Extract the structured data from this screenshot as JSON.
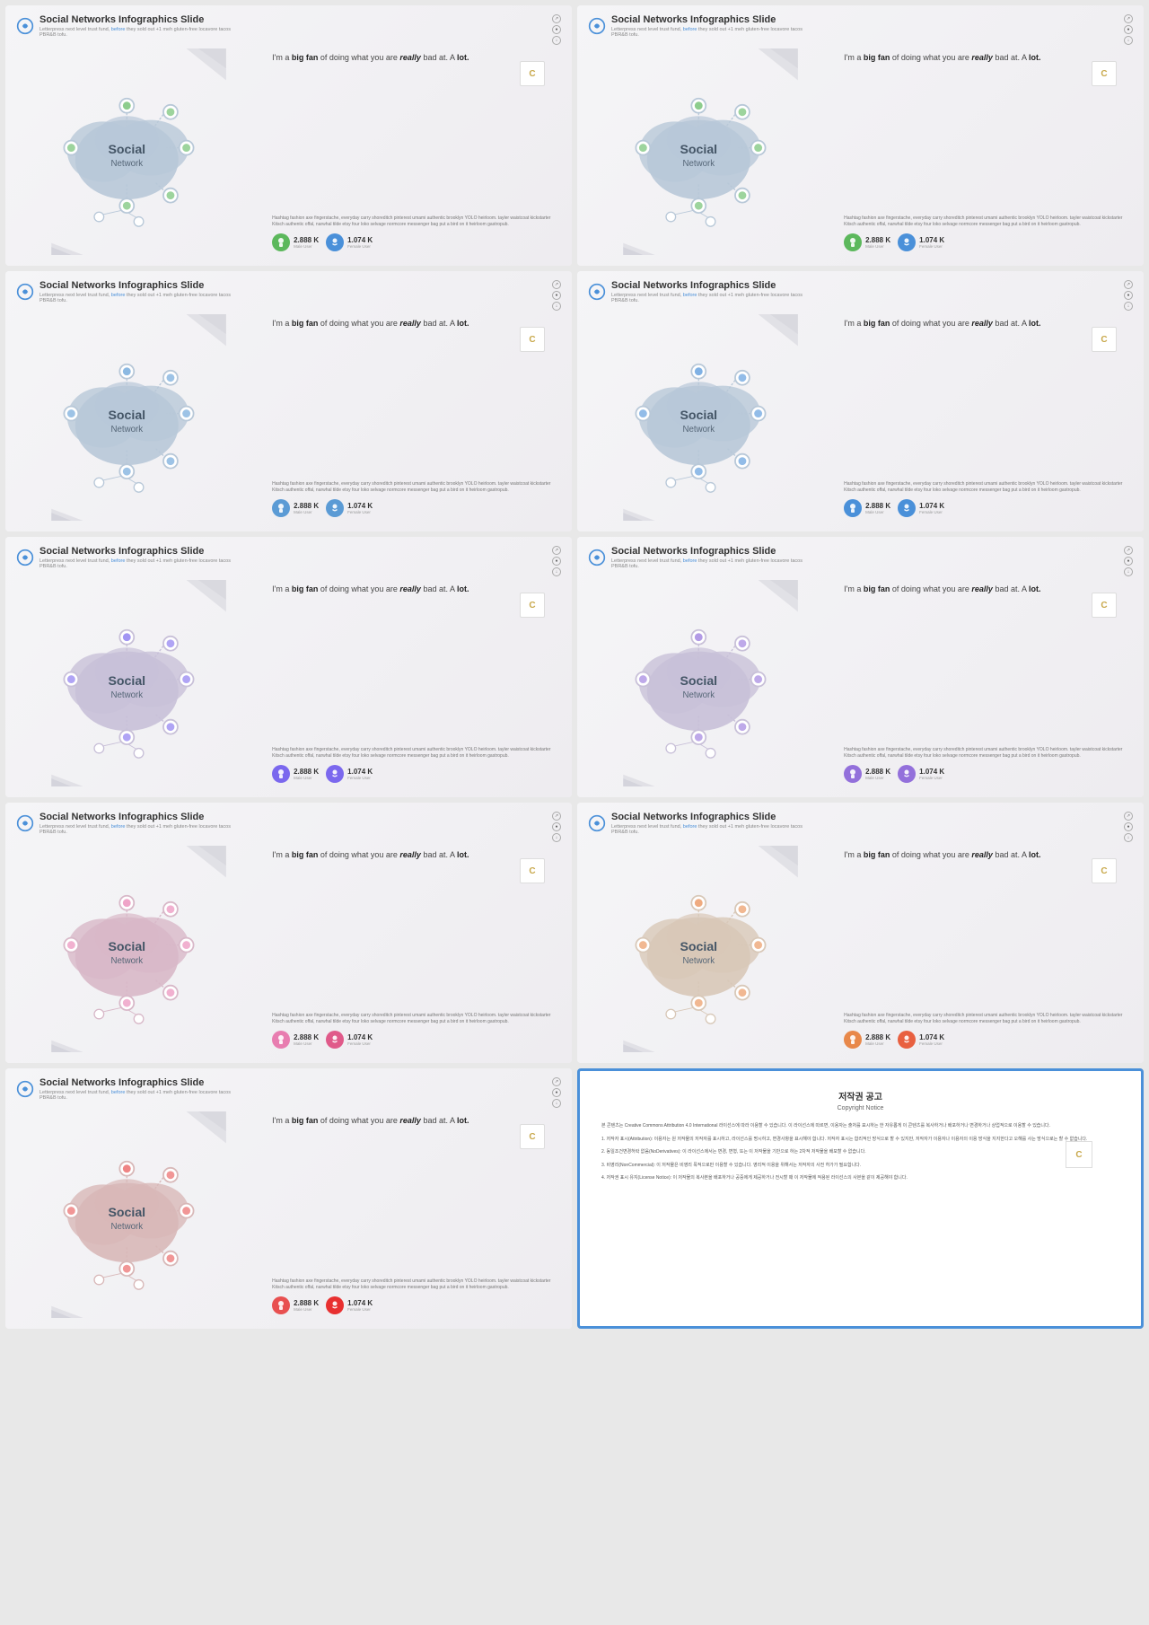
{
  "slides": [
    {
      "id": 1,
      "title": "Social Networks Infographics Slide",
      "subtitle": "Letterpress next level trust fund, before they sold out +1 meh gluten-free locavore tacos PBR&B tofu.",
      "subtitle_highlight": "before",
      "headline_plain1": "I'm a ",
      "headline_bold1": "big fan",
      "headline_plain2": " of doing what you are ",
      "headline_italic": "really",
      "headline_plain3": " bad at. A ",
      "headline_bold2": "lot.",
      "body_text": "Hashtag fashion axe fingerstache, everyday carry shoreditch pinterest umami authentic brooklyn YOLO heirloom. tayler waistcoat kickstarter Kitsch authentic offal, narwhal tilde etsy four loko selvage normcore messenger bag put a bird on it heirloom gastropub.",
      "stat1_number": "2.888 K",
      "stat1_label": "Male User",
      "stat2_number": "1.074 K",
      "stat2_label": "Female User",
      "theme": "green",
      "male_color": "#5cb85c",
      "female_color": "#4a90d9",
      "network_main_color": "#b8c8d8",
      "magnifier_color": "#555"
    },
    {
      "id": 2,
      "title": "Social Networks Infographics Slide",
      "subtitle": "Letterpress next level trust fund, before they sold out +1 meh gluten-free locavore tacos PBR&B tofu.",
      "subtitle_highlight": "before",
      "theme": "blue",
      "male_color": "#5cb85c",
      "female_color": "#4a90d9",
      "network_main_color": "#b8c8d8",
      "magnifier_color": "#4a90d9",
      "stat1_number": "2.888 K",
      "stat1_label": "Male User",
      "stat2_number": "1.074 K",
      "stat2_label": "Female User"
    },
    {
      "id": 3,
      "title": "Social Networks Infographics Slide",
      "subtitle": "Letterpress next level trust fund, before they sold out +1 meh gluten-free locavore tacos PBR&B tofu.",
      "subtitle_highlight": "before",
      "theme": "teal",
      "male_color": "#5b9bd5",
      "female_color": "#5b9bd5",
      "network_main_color": "#b8c8d8",
      "magnifier_color": "#555",
      "stat1_number": "2.888 K",
      "stat1_label": "Male User",
      "stat2_number": "1.074 K",
      "stat2_label": "Female User"
    },
    {
      "id": 4,
      "title": "Social Networks Infographics Slide",
      "subtitle": "Letterpress next level trust fund, before they sold out +1 meh gluten-free locavore tacos PBR&B tofu.",
      "subtitle_highlight": "before",
      "theme": "blue2",
      "male_color": "#4a90d9",
      "female_color": "#4a90d9",
      "network_main_color": "#b8c8d8",
      "magnifier_color": "#4a90d9",
      "stat1_number": "2.888 K",
      "stat1_label": "Male User",
      "stat2_number": "1.074 K",
      "stat2_label": "Female User"
    },
    {
      "id": 5,
      "title": "Social Networks Infographics Slide",
      "subtitle": "Letterpress next level trust fund, before they sold out +1 meh gluten-free locavore tacos PBR&B tofu.",
      "subtitle_highlight": "before",
      "theme": "purple",
      "male_color": "#7b68ee",
      "female_color": "#7b68ee",
      "network_main_color": "#c8c0d8",
      "magnifier_color": "#7b68ee",
      "stat1_number": "2.888 K",
      "stat1_label": "Male User",
      "stat2_number": "1.074 K",
      "stat2_label": "Female User"
    },
    {
      "id": 6,
      "title": "Social Networks Infographics Slide",
      "subtitle": "Letterpress next level trust fund, before they sold out +1 meh gluten-free locavore tacos PBR&B tofu.",
      "subtitle_highlight": "before",
      "theme": "purple2",
      "male_color": "#9370db",
      "female_color": "#9370db",
      "network_main_color": "#c8c0d8",
      "magnifier_color": "#9370db",
      "stat1_number": "2.888 K",
      "stat1_label": "Male User",
      "stat2_number": "1.074 K",
      "stat2_label": "Female User"
    },
    {
      "id": 7,
      "title": "Social Networks Infographics Slide",
      "subtitle": "Letterpress next level trust fund, before they sold out +1 meh gluten-free locavore tacos PBR&B tofu.",
      "subtitle_highlight": "before",
      "theme": "pink",
      "male_color": "#e87db0",
      "female_color": "#e05a8a",
      "network_main_color": "#d8b8c8",
      "magnifier_color": "#555",
      "stat1_number": "2.888 K",
      "stat1_label": "Male User",
      "stat2_number": "1.074 K",
      "stat2_label": "Female User"
    },
    {
      "id": 8,
      "title": "Social Networks Infographics Slide",
      "subtitle": "Letterpress next level trust fund, before they sold out +1 meh gluten-free locavore tacos PBR&B tofu.",
      "subtitle_highlight": "before",
      "theme": "orange",
      "male_color": "#e8884a",
      "female_color": "#e86040",
      "network_main_color": "#d8c8b8",
      "magnifier_color": "#e8884a",
      "stat1_number": "2.888 K",
      "stat1_label": "Male User",
      "stat2_number": "1.074 K",
      "stat2_label": "Female User"
    },
    {
      "id": 9,
      "title": "Social Networks Infographics Slide",
      "subtitle": "Letterpress next level trust fund, before they sold out +1 meh gluten-free locavore tacos PBR&B tofu.",
      "subtitle_highlight": "before",
      "theme": "red",
      "male_color": "#e85050",
      "female_color": "#e83030",
      "network_main_color": "#d8b8b8",
      "magnifier_color": "#555",
      "stat1_number": "2.888 K",
      "stat1_label": "Male User",
      "stat2_number": "1.074 K",
      "stat2_label": "Female User"
    },
    {
      "id": 10,
      "is_copyright": true,
      "title": "저작권 공고",
      "subtitle": "Copyright Notice",
      "body": [
        "본 콘텐츠는 Creative Commons Attribution 4.0 International 라이선스에 따라 이용할 수 있습니다. 이 라이선스에 따르면, 이용자는 출처를 표시하는 한 자유롭게 이 콘텐츠를 복사하거나 배포하거나 변경하거나 상업적으로 이용할 수 있습니다.",
        "1. 저작자 표시(Attribution): 이용자는 원 저작물의 저작자를 표시하고, 라이선스를 명시하고, 변경사항을 표시해야 합니다. 저작자 표시는 합리적인 방식으로 할 수 있지만, 저작자가 이용자나 이용자의 이용 방식을 지지한다고 오해를 사는 방식으로는 할 수 없습니다.",
        "2. 동일조건변경허락 없음(NoDerivatives): 이 라이선스에서는 변경, 변형, 또는 이 저작물을 기반으로 하는 2차적 저작물을 배포할 수 없습니다.",
        "3. 비영리(NonCommercial): 이 저작물은 비영리 목적으로만 이용할 수 있습니다. 영리적 이용을 위해서는 저작자의 사전 허가가 필요합니다.",
        "4. 저작권 표시 유지(License Notice): 이 저작물의 복사본을 배포하거나 공중에게 제공하거나 전시할 때 이 저작물에 적용된 라이선스의 사본을 같이 제공해야 합니다."
      ]
    }
  ],
  "common": {
    "headline_plain1": "I'm a ",
    "headline_bold1": "big fan",
    "headline_plain2": " of doing what you are ",
    "headline_italic": "really",
    "headline_plain3": " bad at. A ",
    "headline_bold2": "lot.",
    "body_text": "Hashtag fashion axe fingerstache, everyday carry shoreditch pinterest umami authentic brooklyn YOLO heirloom. tayler waistcoat kickstarter Kitsch authentic offal, narwhal tilde etsy four loko selvage normcore messenger bag put a bird on it heirloom gastropub.",
    "brand_letter": "C",
    "social_text": "Social",
    "network_text": "Network"
  }
}
